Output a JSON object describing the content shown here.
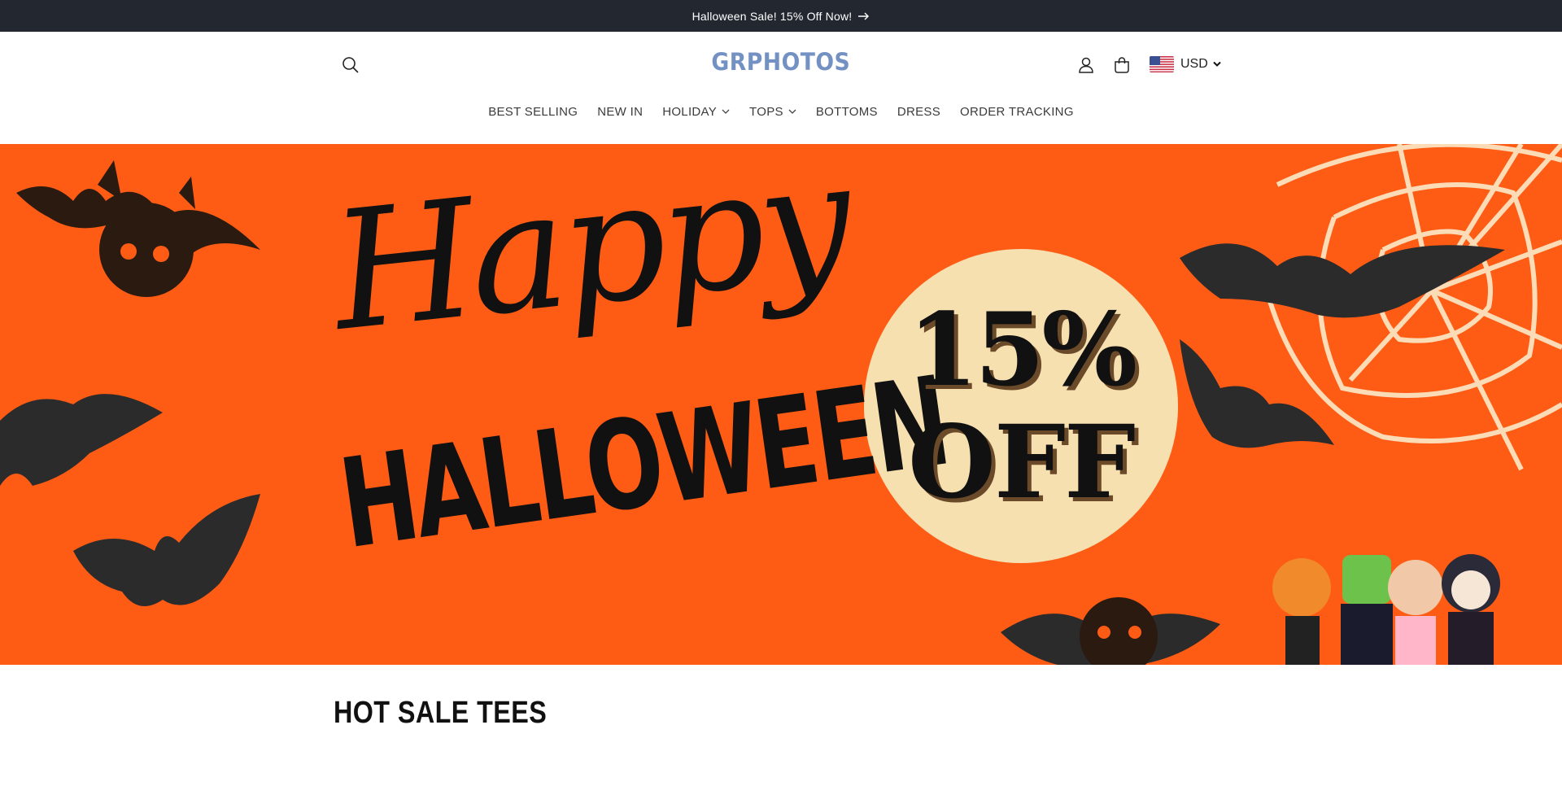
{
  "announcement": {
    "text": "Halloween Sale! 15% Off Now!",
    "icon": "arrow-right-icon"
  },
  "header": {
    "logo": "GRPHOTOS",
    "search_icon": "search-icon",
    "account_icon": "user-icon",
    "cart_icon": "cart-icon",
    "currency": {
      "code": "USD",
      "flag": "us-flag-icon"
    }
  },
  "nav": {
    "items": [
      {
        "label": "BEST SELLING",
        "dropdown": false
      },
      {
        "label": "NEW IN",
        "dropdown": false
      },
      {
        "label": "HOLIDAY",
        "dropdown": true
      },
      {
        "label": "TOPS",
        "dropdown": true
      },
      {
        "label": "BOTTOMS",
        "dropdown": false
      },
      {
        "label": "DRESS",
        "dropdown": false
      },
      {
        "label": "ORDER TRACKING",
        "dropdown": false
      }
    ]
  },
  "hero": {
    "line1": "Happy",
    "line2": "HALLOWEEN",
    "badge_line1": "15%",
    "badge_line2": "OFF"
  },
  "section": {
    "title": "HOT SALE TEES"
  },
  "colors": {
    "announcement_bg": "#232730",
    "logo": "#7391c2",
    "hero_bg": "#fe5c15",
    "badge": "#f6e0b0"
  }
}
